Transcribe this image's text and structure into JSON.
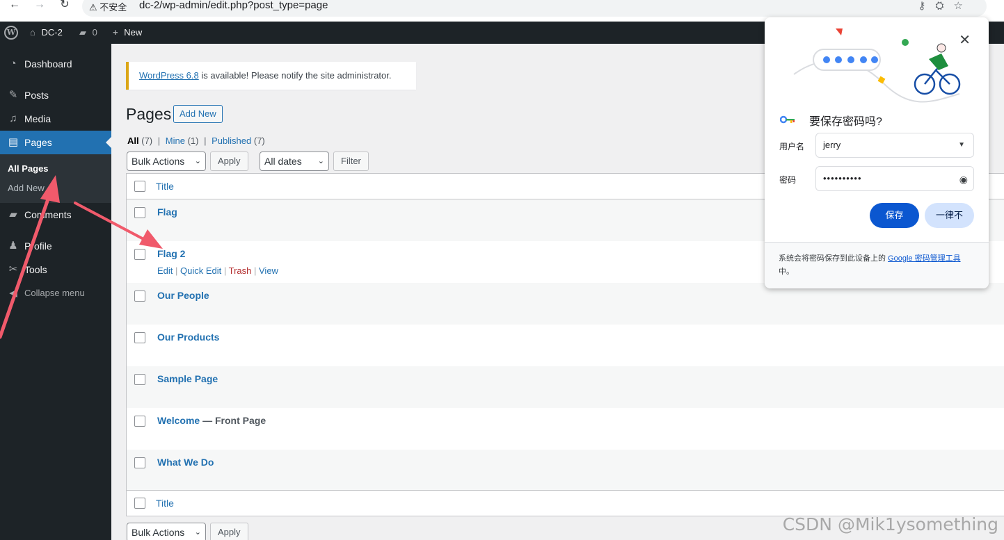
{
  "browser": {
    "security_label": "不安全",
    "url": "dc-2/wp-admin/edit.php?post_type=page"
  },
  "adminbar": {
    "site_name": "DC-2",
    "comments_count": "0",
    "new_label": "New"
  },
  "sidebar": {
    "items": [
      {
        "label": "Dashboard",
        "icon": "dashboard-icon"
      },
      {
        "label": "Posts",
        "icon": "pin-icon"
      },
      {
        "label": "Media",
        "icon": "media-icon"
      },
      {
        "label": "Pages",
        "icon": "pages-icon"
      },
      {
        "label": "Comments",
        "icon": "comment-icon"
      },
      {
        "label": "Profile",
        "icon": "user-icon"
      },
      {
        "label": "Tools",
        "icon": "wrench-icon"
      }
    ],
    "submenu": [
      "All Pages",
      "Add New"
    ],
    "collapse_label": "Collapse menu"
  },
  "notice": {
    "link_text": "WordPress 6.8",
    "text": " is available! Please notify the site administrator."
  },
  "page": {
    "title": "Pages",
    "add_new": "Add New"
  },
  "filters": {
    "all": "All",
    "all_count": "(7)",
    "mine": "Mine",
    "mine_count": "(1)",
    "published": "Published",
    "published_count": "(7)",
    "bulk_actions": "Bulk Actions",
    "apply": "Apply",
    "all_dates": "All dates",
    "filter": "Filter"
  },
  "table": {
    "column_title": "Title",
    "rows": [
      {
        "title": "Flag",
        "state": ""
      },
      {
        "title": "Flag 2",
        "state": ""
      },
      {
        "title": "Our People",
        "state": ""
      },
      {
        "title": "Our Products",
        "state": ""
      },
      {
        "title": "Sample Page",
        "state": ""
      },
      {
        "title": "Welcome",
        "state": " — Front Page"
      },
      {
        "title": "What We Do",
        "state": ""
      }
    ],
    "row_actions": {
      "edit": "Edit",
      "quick_edit": "Quick Edit",
      "trash": "Trash",
      "view": "View"
    }
  },
  "password_popup": {
    "title": "要保存密码吗?",
    "username_label": "用户名",
    "username_value": "jerry",
    "password_label": "密码",
    "password_value": "••••••••••",
    "save": "保存",
    "never": "一律不",
    "footer_text": "系统会将密码保存到此设备上的 ",
    "footer_link": "Google 密码管理工具",
    "footer_tail": "中。"
  },
  "watermark": "CSDN @Mik1ysomething",
  "colors": {
    "wp_blue": "#2271b1",
    "admin_dark": "#1d2327",
    "google_blue": "#0b57d0",
    "annotation_red": "#f05a6b"
  }
}
